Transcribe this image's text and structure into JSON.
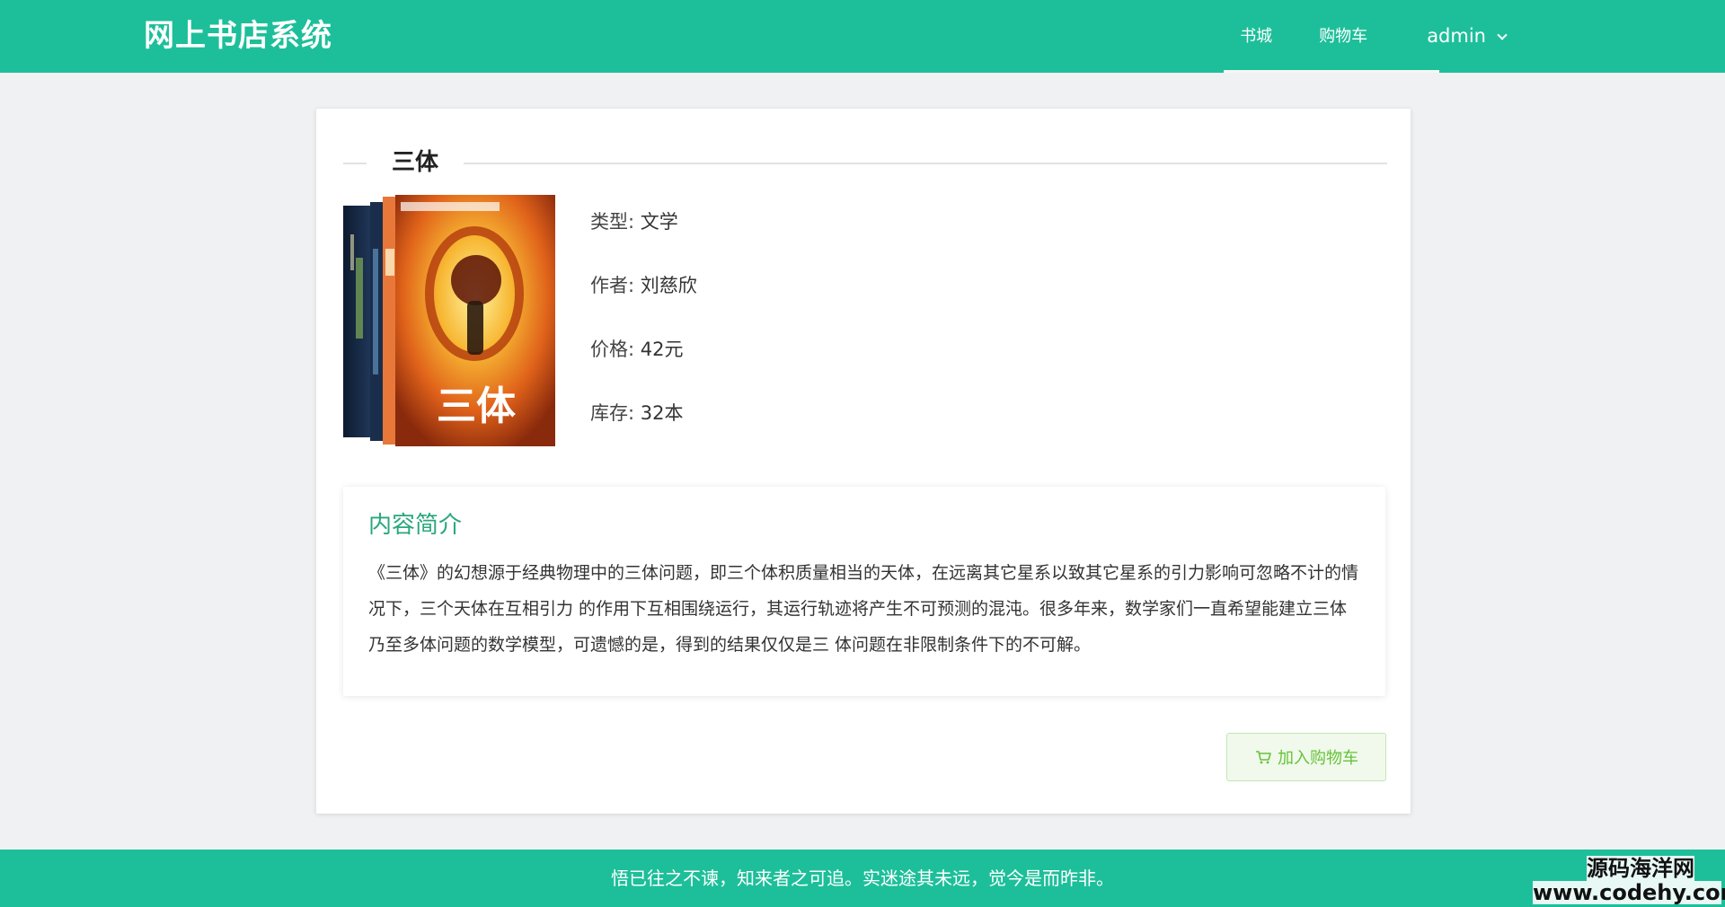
{
  "header": {
    "brand": "网上书店系统",
    "nav": {
      "bookstore": "书城",
      "cart": "购物车",
      "user": "admin"
    },
    "colors": {
      "primary": "#1dbf9a"
    }
  },
  "book": {
    "title": "三体",
    "cover_alt": "三体 封面",
    "type_label": "类型:",
    "type_value": "文学",
    "author_label": "作者:",
    "author_value": "刘慈欣",
    "price_label": "价格:",
    "price_value": "42元",
    "stock_label": "库存:",
    "stock_value": "32本",
    "cover_text": "三体"
  },
  "description": {
    "title": "内容简介",
    "text": "《三体》的幻想源于经典物理中的三体问题，即三个体积质量相当的天体，在远离其它星系以致其它星系的引力影响可忽略不计的情况下，三个天体在互相引力 的作用下互相围绕运行，其运行轨迹将产生不可预测的混沌。很多年来，数学家们一直希望能建立三体乃至多体问题的数学模型，可遗憾的是，得到的结果仅仅是三 体问题在非限制条件下的不可解。"
  },
  "actions": {
    "add_to_cart": "加入购物车"
  },
  "footer": {
    "motto": "悟已往之不谏，知来者之可追。实迷途其未远，觉今是而昨非。"
  },
  "watermark": {
    "line1": "源码海洋网",
    "line2": "www.codehy.com"
  }
}
